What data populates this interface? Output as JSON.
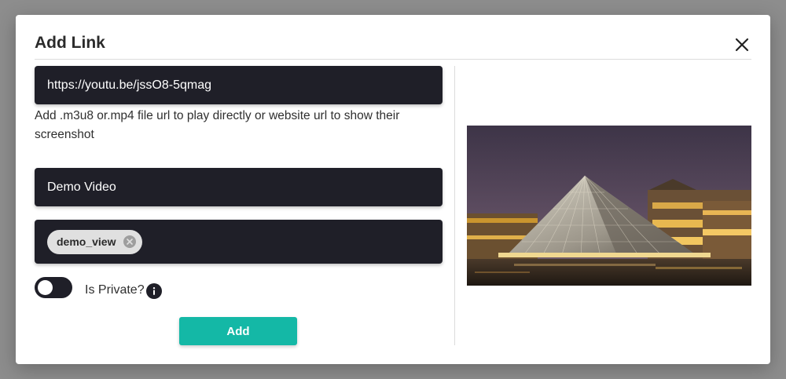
{
  "modal": {
    "title": "Add Link",
    "close_icon": "close-icon"
  },
  "form": {
    "url_value": "https://youtu.be/jssO8-5qmag",
    "url_hint": "Add .m3u8 or.mp4 file url to play directly or website url to show their screenshot",
    "title_value": "Demo Video",
    "tags": [
      {
        "label": "demo_view"
      }
    ],
    "private_label": "Is Private?",
    "private_enabled": false,
    "add_label": "Add"
  },
  "preview": {
    "image": "louvre-pyramid-night-thumbnail"
  },
  "colors": {
    "field_bg": "#1f1f28",
    "accent": "#14b8a6",
    "backdrop": "#8d8d8d"
  }
}
